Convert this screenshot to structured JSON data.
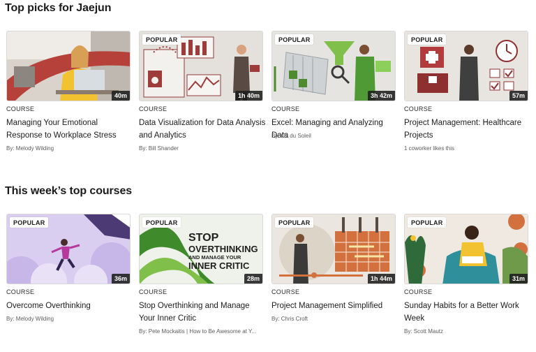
{
  "sections": [
    {
      "title": "Top picks for Jaejun",
      "cards": [
        {
          "kind": "COURSE",
          "title": "Managing Your Emotional Response to Workplace Stress",
          "meta": "By: Melody Wilding",
          "duration": "40m",
          "badge": ""
        },
        {
          "kind": "COURSE",
          "title": "Data Visualization for Data Analysis and Analytics",
          "meta": "By: Bill Shander",
          "duration": "1h 40m",
          "badge": "POPULAR"
        },
        {
          "kind": "COURSE",
          "title": "Excel: Managing and Analyzing Data",
          "meta": "By: Oz du Soleil",
          "duration": "3h 42m",
          "badge": "POPULAR"
        },
        {
          "kind": "COURSE",
          "title": "Project Management: Healthcare Projects",
          "meta": "1 coworker likes this",
          "duration": "57m",
          "badge": "POPULAR"
        }
      ]
    },
    {
      "title": "This week’s top courses",
      "cards": [
        {
          "kind": "COURSE",
          "title": "Overcome Overthinking",
          "meta": "By: Melody Wilding",
          "duration": "36m",
          "badge": "POPULAR"
        },
        {
          "kind": "COURSE",
          "title": "Stop Overthinking and Manage Your Inner Critic",
          "meta": "By: Pete Mockaitis | How to Be Awesome at Y...",
          "duration": "28m",
          "badge": "POPULAR"
        },
        {
          "kind": "COURSE",
          "title": "Project Management Simplified",
          "meta": "By: Chris Croft",
          "duration": "1h 44m",
          "badge": "POPULAR"
        },
        {
          "kind": "COURSE",
          "title": "Sunday Habits for a Better Work Week",
          "meta": "By: Scott Mautz",
          "duration": "31m",
          "badge": "POPULAR"
        }
      ]
    }
  ],
  "thumbnail_text": {
    "stop_overthinking": [
      "STOP",
      "OVERTHINKING",
      "AND MANAGE YOUR",
      "INNER CRITIC"
    ]
  },
  "colors": {
    "accent_red": "#9e3b3b",
    "thumb_gray": "#e6e2de",
    "purple": "#c7b6e8",
    "green": "#4e8a2f",
    "orange": "#d2703e"
  }
}
